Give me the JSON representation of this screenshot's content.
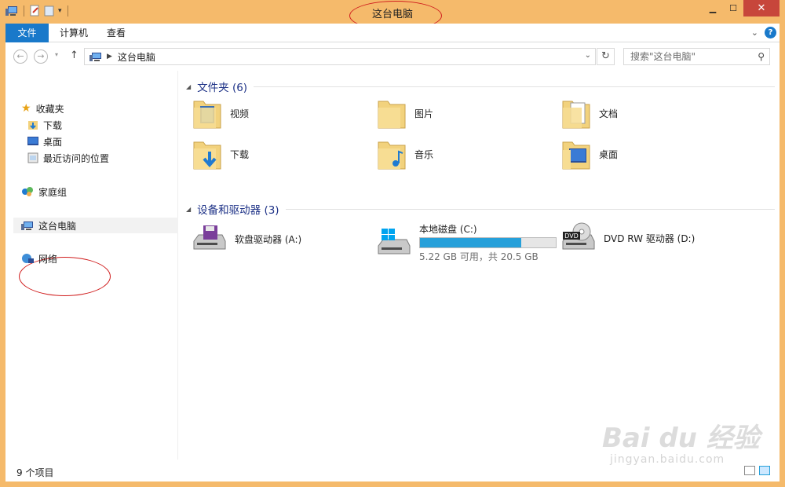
{
  "window": {
    "title": "这台电脑"
  },
  "ribbon": {
    "tabs": [
      {
        "label": "文件"
      },
      {
        "label": "计算机"
      },
      {
        "label": "查看"
      }
    ]
  },
  "address_bar": {
    "path": "这台电脑",
    "search_placeholder": "搜索\"这台电脑\""
  },
  "nav_pane": {
    "favorites": "收藏夹",
    "favorites_items": [
      "下载",
      "桌面",
      "最近访问的位置"
    ],
    "homegroup": "家庭组",
    "this_pc": "这台电脑",
    "network": "网络"
  },
  "folders": {
    "header": "文件夹 (6)",
    "items": [
      {
        "label": "视频",
        "icon": "video-folder-icon"
      },
      {
        "label": "图片",
        "icon": "pictures-folder-icon"
      },
      {
        "label": "文档",
        "icon": "documents-folder-icon"
      },
      {
        "label": "下载",
        "icon": "downloads-folder-icon"
      },
      {
        "label": "音乐",
        "icon": "music-folder-icon"
      },
      {
        "label": "桌面",
        "icon": "desktop-folder-icon"
      }
    ]
  },
  "devices": {
    "header": "设备和驱动器 (3)",
    "floppy": {
      "label": "软盘驱动器 (A:)"
    },
    "local_disk": {
      "label": "本地磁盘 (C:)",
      "free_text": "5.22 GB 可用，共 20.5 GB",
      "used_fraction": 0.745
    },
    "dvd": {
      "label": "DVD RW 驱动器 (D:)"
    }
  },
  "status": {
    "count": "9 个项目"
  },
  "watermark": {
    "main": "Bai du 经验",
    "sub": "jingyan.baidu.com"
  },
  "colors": {
    "accent": "#1979ca",
    "frame": "#f5ba6b",
    "group_header": "#1e3287",
    "progress": "#26a0da",
    "close": "#c7463b"
  }
}
